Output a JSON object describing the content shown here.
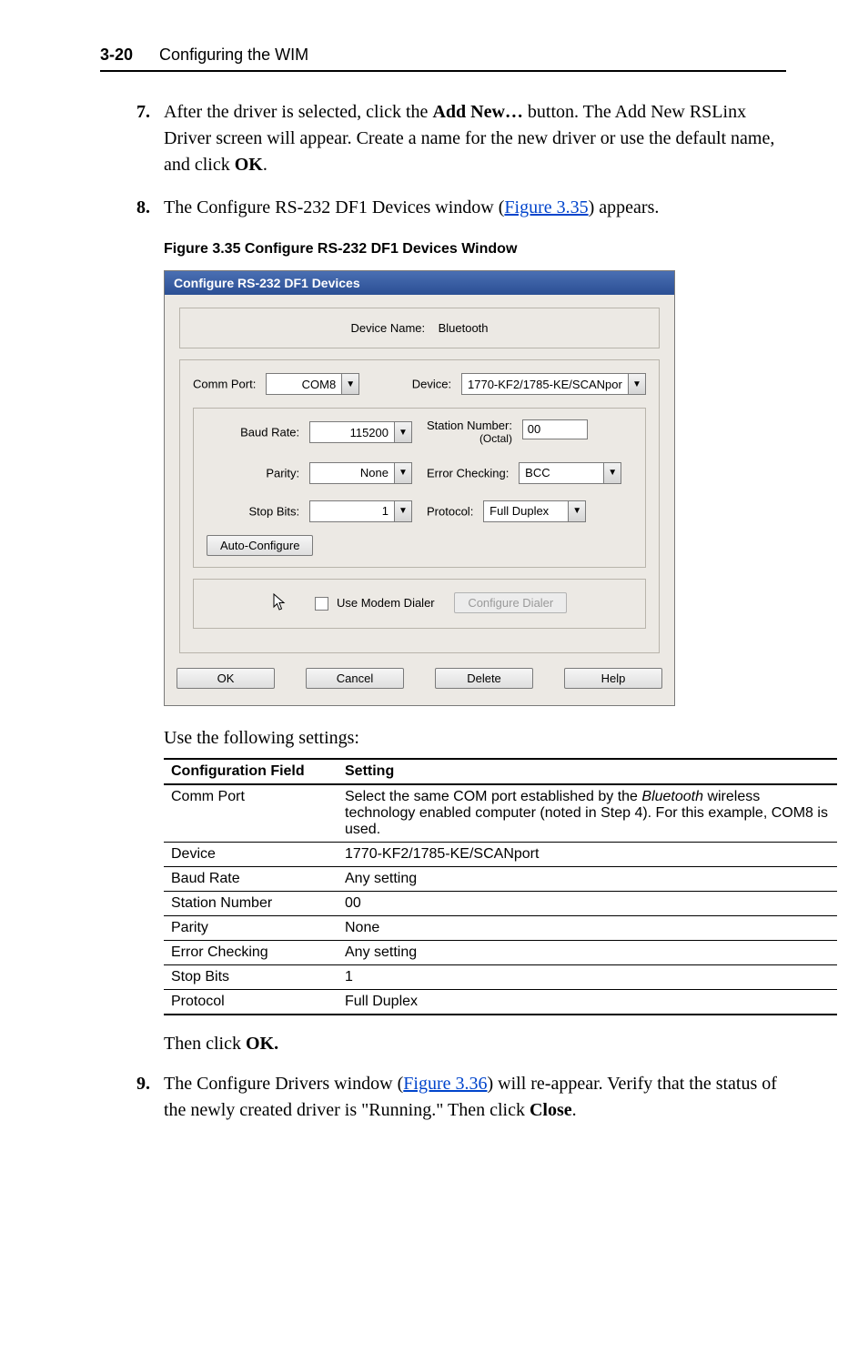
{
  "header": {
    "page_number": "3-20",
    "title": "Configuring the WIM"
  },
  "steps": {
    "s7": {
      "num": "7.",
      "text_pre": "After the driver is selected, click the ",
      "add_new": "Add New…",
      "text_mid": " button. The Add New RSLinx Driver screen will appear. Create a name for the new driver or use the default name, and click ",
      "ok": "OK",
      "text_end": "."
    },
    "s8": {
      "num": "8.",
      "text_pre": "The Configure RS-232 DF1 Devices window (",
      "link": "Figure 3.35",
      "text_post": ") appears."
    },
    "s9": {
      "num": "9.",
      "text_pre": "The Configure Drivers window (",
      "link": "Figure 3.36",
      "text_mid": ") will re-appear. Verify that the status of the newly created driver is \"Running.\" Then click ",
      "close": "Close",
      "text_end": "."
    }
  },
  "figure_caption": "Figure 3.35   Configure RS-232 DF1 Devices Window",
  "dialog": {
    "title": "Configure RS-232 DF1 Devices",
    "device_name_label": "Device Name:",
    "device_name_value": "Bluetooth",
    "comm_port_label": "Comm Port:",
    "comm_port_value": "COM8",
    "device_label": "Device:",
    "device_value": "1770-KF2/1785-KE/SCANpor",
    "baud_label": "Baud Rate:",
    "baud_value": "115200",
    "station_label": "Station Number:",
    "station_sub": "(Octal)",
    "station_value": "00",
    "parity_label": "Parity:",
    "parity_value": "None",
    "errchk_label": "Error Checking:",
    "errchk_value": "BCC",
    "stopbits_label": "Stop Bits:",
    "stopbits_value": "1",
    "protocol_label": "Protocol:",
    "protocol_value": "Full Duplex",
    "auto_configure": "Auto-Configure",
    "use_modem": "Use Modem Dialer",
    "configure_dialer": "Configure Dialer",
    "ok": "OK",
    "cancel": "Cancel",
    "delete": "Delete",
    "help": "Help"
  },
  "use_following": "Use the following settings:",
  "table": {
    "h_field": "Configuration Field",
    "h_setting": "Setting",
    "rows": [
      {
        "field": "Comm Port",
        "setting_pre": "Select the same COM port established by the ",
        "setting_ital": "Bluetooth",
        "setting_post": " wireless technology enabled computer (noted in Step 4). For this example, COM8 is used."
      },
      {
        "field": "Device",
        "setting": "1770-KF2/1785-KE/SCANport"
      },
      {
        "field": "Baud Rate",
        "setting": "Any setting"
      },
      {
        "field": "Station Number",
        "setting": "00"
      },
      {
        "field": "Parity",
        "setting": "None"
      },
      {
        "field": "Error Checking",
        "setting": "Any setting"
      },
      {
        "field": "Stop Bits",
        "setting": "1"
      },
      {
        "field": "Protocol",
        "setting": "Full Duplex"
      }
    ]
  },
  "then_click_pre": "Then click ",
  "then_click_ok": "OK."
}
